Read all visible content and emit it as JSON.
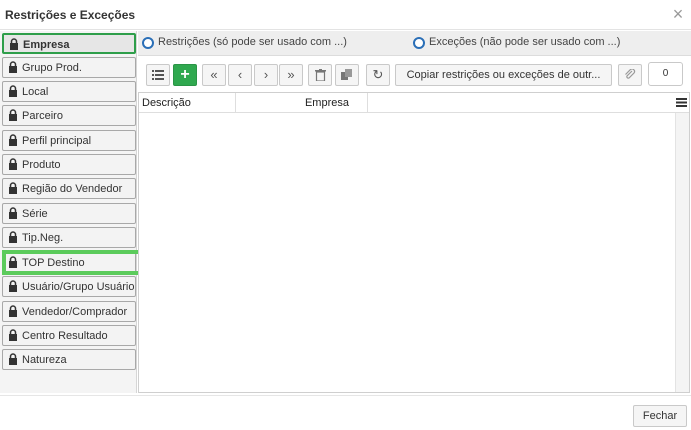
{
  "dialog": {
    "title": "Restrições e Exceções",
    "close_symbol": "×"
  },
  "sidebar": {
    "items": [
      {
        "label": "Empresa",
        "active": true
      },
      {
        "label": "Grupo Prod."
      },
      {
        "label": "Local"
      },
      {
        "label": "Parceiro"
      },
      {
        "label": "Perfil principal"
      },
      {
        "label": "Produto"
      },
      {
        "label": "Região do Vendedor"
      },
      {
        "label": "Série"
      },
      {
        "label": "Tip.Neg."
      },
      {
        "label": "TOP Destino",
        "highlighted": true
      },
      {
        "label": "Usuário/Grupo Usuário"
      },
      {
        "label": "Vendedor/Comprador"
      },
      {
        "label": "Centro Resultado"
      },
      {
        "label": "Natureza"
      }
    ],
    "icon": "lock-icon"
  },
  "radios": {
    "restrictions": "Restrições (só pode ser usado com ...)",
    "exceptions": "Exceções (não pode ser usado com ...)"
  },
  "toolbar": {
    "copy_label": "Copiar restrições ou exceções de outr...",
    "counter_value": "0",
    "icons": [
      "list-icon",
      "add-icon",
      "first-page-icon",
      "prev-icon",
      "next-icon",
      "last-page-icon",
      "delete-icon",
      "duplicate-icon",
      "refresh-icon",
      "attach-icon"
    ]
  },
  "grid": {
    "columns": [
      "Descrição",
      "Empresa"
    ],
    "rows": []
  },
  "footer": {
    "close_label": "Fechar"
  },
  "colors": {
    "accent_green": "#2fa84f",
    "highlight_green": "#5bcb5b",
    "radio_blue": "#2b6fb7"
  }
}
